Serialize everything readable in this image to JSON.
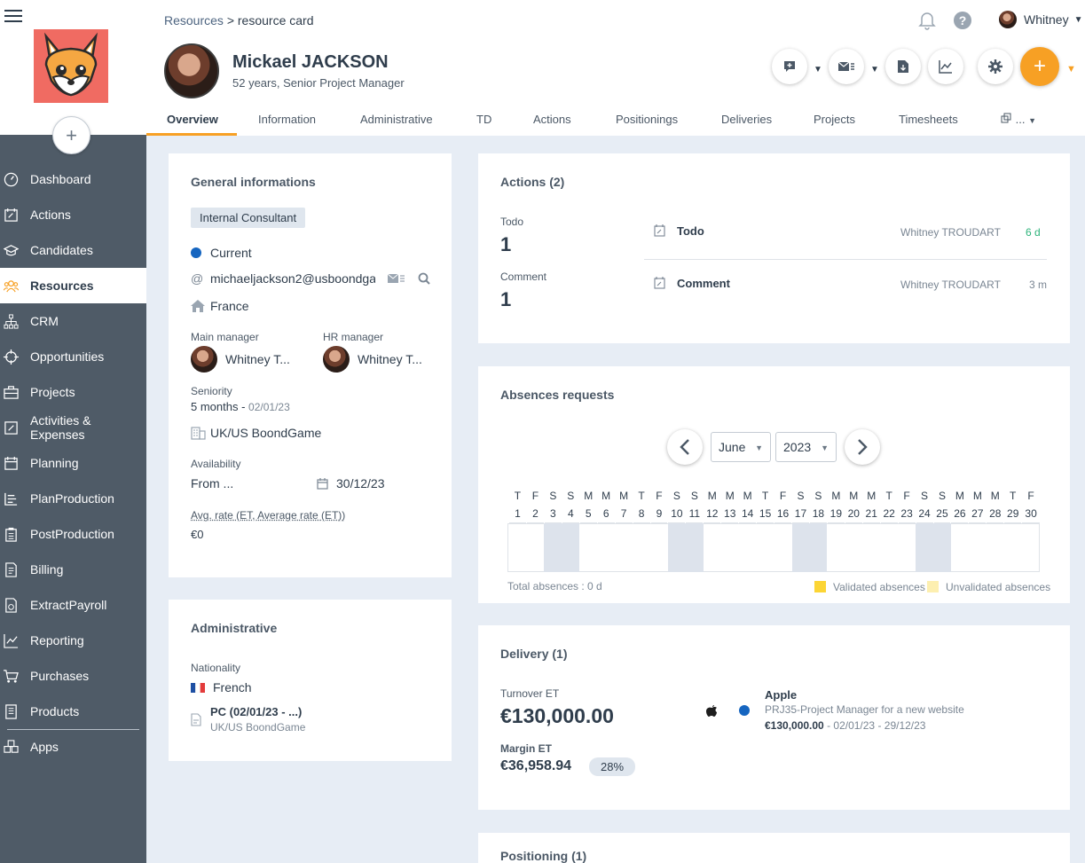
{
  "sidebar": {
    "items": [
      {
        "label": "Dashboard",
        "icon": "gauge-icon"
      },
      {
        "label": "Actions",
        "icon": "calendar-edit-icon"
      },
      {
        "label": "Candidates",
        "icon": "graduation-cap-icon"
      },
      {
        "label": "Resources",
        "icon": "users-icon",
        "active": true
      },
      {
        "label": "CRM",
        "icon": "sitemap-icon"
      },
      {
        "label": "Opportunities",
        "icon": "crosshair-icon"
      },
      {
        "label": "Projects",
        "icon": "briefcase-icon"
      },
      {
        "label": "Activities & Expenses",
        "icon": "edit-square-icon"
      },
      {
        "label": "Planning",
        "icon": "calendar-icon"
      },
      {
        "label": "PlanProduction",
        "icon": "bar-list-icon"
      },
      {
        "label": "PostProduction",
        "icon": "clipboard-icon"
      },
      {
        "label": "Billing",
        "icon": "invoice-icon"
      },
      {
        "label": "ExtractPayroll",
        "icon": "payroll-icon"
      },
      {
        "label": "Reporting",
        "icon": "line-chart-icon"
      },
      {
        "label": "Purchases",
        "icon": "cart-icon"
      },
      {
        "label": "Products",
        "icon": "catalog-icon"
      },
      {
        "label": "Apps",
        "icon": "apps-icon"
      }
    ]
  },
  "header": {
    "breadcrumb_link": "Resources",
    "breadcrumb_sep": ">",
    "breadcrumb_current": "resource card",
    "user_name": "Whitney",
    "help_glyph": "?",
    "add_glyph": "+",
    "name": "Mickael JACKSON",
    "subtitle": "52 years, Senior Project Manager",
    "accent_color": "#f7a024"
  },
  "tabs": [
    "Overview",
    "Information",
    "Administrative",
    "TD",
    "Actions",
    "Positionings",
    "Deliveries",
    "Projects",
    "Timesheets"
  ],
  "tab_more": "...",
  "general": {
    "title": "General informations",
    "badge": "Internal Consultant",
    "status": "Current",
    "email": "michaeljackson2@usboondga",
    "at": "@",
    "country": "France",
    "main_manager_label": "Main manager",
    "main_manager": "Whitney T...",
    "hr_manager_label": "HR manager",
    "hr_manager": "Whitney T...",
    "seniority_label": "Seniority",
    "seniority_value": "5 months",
    "seniority_sep": " - ",
    "seniority_date": "02/01/23",
    "agency": "UK/US BoondGame",
    "availability_label": "Availability",
    "availability_from": "From ...",
    "availability_date": "30/12/23",
    "rate_label": "Avg. rate (ET, Average rate (ET))",
    "rate_value": "€0"
  },
  "administrative": {
    "title": "Administrative",
    "nationality_label": "Nationality",
    "nationality": "French",
    "contract": "PC (02/01/23 - ...)",
    "contract_agency": "UK/US BoondGame"
  },
  "actions": {
    "title": "Actions (2)",
    "todo_label": "Todo",
    "todo_count": "1",
    "comment_label": "Comment",
    "comment_count": "1",
    "rows": [
      {
        "type": "Todo",
        "author": "Whitney TROUDART",
        "age": "6 d"
      },
      {
        "type": "Comment",
        "author": "Whitney TROUDART",
        "age": "3 m"
      }
    ]
  },
  "absences": {
    "title": "Absences requests",
    "month": "June",
    "year": "2023",
    "day_letters": [
      "T",
      "F",
      "S",
      "S",
      "M",
      "M",
      "M",
      "T",
      "F",
      "S",
      "S",
      "M",
      "M",
      "M",
      "T",
      "F",
      "S",
      "S",
      "M",
      "M",
      "M",
      "T",
      "F",
      "S",
      "S",
      "M",
      "M",
      "M",
      "T",
      "F"
    ],
    "day_numbers": [
      "1",
      "2",
      "3",
      "4",
      "5",
      "6",
      "7",
      "8",
      "9",
      "10",
      "11",
      "12",
      "13",
      "14",
      "15",
      "16",
      "17",
      "18",
      "19",
      "20",
      "21",
      "22",
      "23",
      "24",
      "25",
      "26",
      "27",
      "28",
      "29",
      "30"
    ],
    "weekend_days": [
      3,
      4,
      10,
      11,
      17,
      18,
      24,
      25
    ],
    "total": "Total absences : 0 d",
    "legend_validated": "Validated absences",
    "legend_unvalidated": "Unvalidated absences",
    "validated_color": "#fcd535",
    "unvalidated_color": "#fdefb0"
  },
  "delivery": {
    "title": "Delivery (1)",
    "turnover_label": "Turnover ET",
    "turnover": "€130,000.00",
    "margin_label": "Margin ET",
    "margin": "€36,958.94",
    "margin_pct": "28%",
    "company": "Apple",
    "project": "PRJ35-Project Manager for a new website",
    "amount": "€130,000.00",
    "dates": " - 02/01/23 - 29/12/23"
  },
  "positioning": {
    "title": "Positioning (1)"
  }
}
